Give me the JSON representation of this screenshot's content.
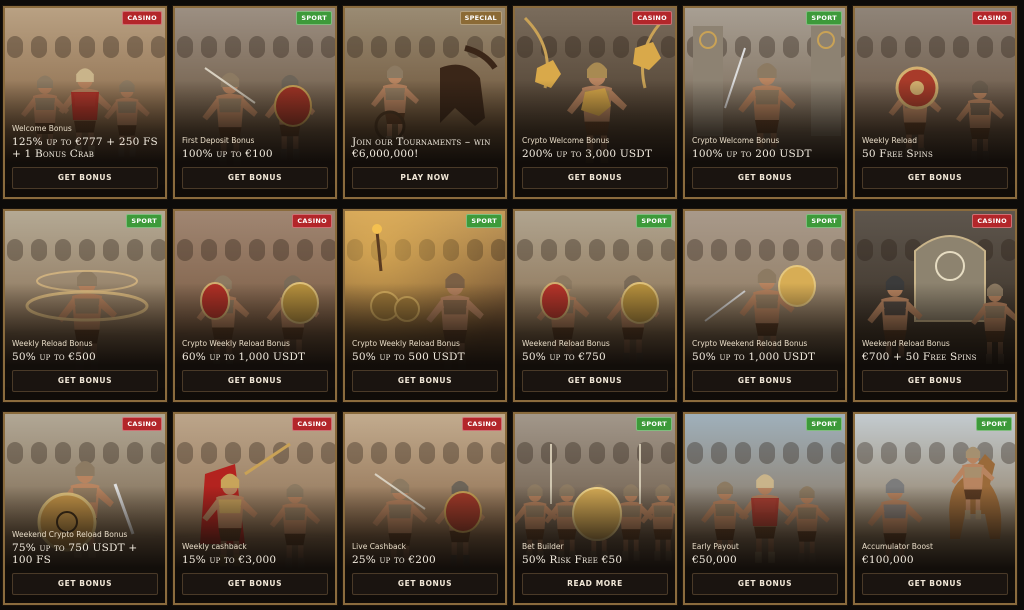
{
  "promotions": [
    {
      "badge": "CASINO",
      "badge_type": "casino",
      "subtitle": "Welcome Bonus",
      "title": "125% up to €777 + 250 FS + 1 Bonus Crab",
      "button": "GET BONUS",
      "scene": "arena-group",
      "sky": "#b9a183",
      "ground": "#8a6a4a",
      "accent": "#b52a22"
    },
    {
      "badge": "SPORT",
      "badge_type": "sport",
      "subtitle": "First Deposit Bonus",
      "title": "100% up to €100",
      "button": "GET BONUS",
      "scene": "fight",
      "sky": "#9c8f82",
      "ground": "#6d5944",
      "accent": "#a23426"
    },
    {
      "badge": "SPECIAL",
      "badge_type": "special",
      "subtitle": "",
      "title": "Join our Tournaments – win €6,000,000!",
      "button": "PLAY NOW",
      "scene": "chariot",
      "sky": "#9a8b73",
      "ground": "#6c5338",
      "accent": "#8a2a20"
    },
    {
      "badge": "CASINO",
      "badge_type": "casino",
      "subtitle": "Crypto Welcome Bonus",
      "title": "200% up to 3,000 USDT",
      "button": "GET BONUS",
      "scene": "coins",
      "sky": "#7a6c5c",
      "ground": "#4e3f30",
      "accent": "#d9a94a"
    },
    {
      "badge": "SPORT",
      "badge_type": "sport",
      "subtitle": "Crypto Welcome Bonus",
      "title": "100% up to 200 USDT",
      "button": "GET BONUS",
      "scene": "pillars",
      "sky": "#a89f93",
      "ground": "#7a6a58",
      "accent": "#c9a256"
    },
    {
      "badge": "CASINO",
      "badge_type": "casino",
      "subtitle": "Weekly Reload",
      "title": "50 Free Spins",
      "button": "GET BONUS",
      "scene": "shield",
      "sky": "#8f8478",
      "ground": "#6a5644",
      "accent": "#a83b2a"
    },
    {
      "badge": "SPORT",
      "badge_type": "sport",
      "subtitle": "Weekly Reload Bonus",
      "title": "50% up to €500",
      "button": "GET BONUS",
      "scene": "spin",
      "sky": "#b4a994",
      "ground": "#8a7258",
      "accent": "#e3c184"
    },
    {
      "badge": "CASINO",
      "badge_type": "casino",
      "subtitle": "Crypto Weekly Reload Bonus",
      "title": "60% up to 1,000 USDT",
      "button": "GET BONUS",
      "scene": "duel",
      "sky": "#a08672",
      "ground": "#7b5c44",
      "accent": "#b23026"
    },
    {
      "badge": "SPORT",
      "badge_type": "sport",
      "subtitle": "Crypto Weekly Reload Bonus",
      "title": "50% up to 500 USDT",
      "button": "GET BONUS",
      "scene": "torch",
      "sky": "#c49a5a",
      "ground": "#6c4c2e",
      "accent": "#f0b04a"
    },
    {
      "badge": "SPORT",
      "badge_type": "sport",
      "subtitle": "Weekend Reload Bonus",
      "title": "50% up to €750",
      "button": "GET BONUS",
      "scene": "duel",
      "sky": "#b0a48f",
      "ground": "#8a7154",
      "accent": "#b8342a"
    },
    {
      "badge": "SPORT",
      "badge_type": "sport",
      "subtitle": "Crypto Weekend Reload Bonus",
      "title": "50% up to 1,000 USDT",
      "button": "GET BONUS",
      "scene": "arena-single",
      "sky": "#a8998a",
      "ground": "#8f7a60",
      "accent": "#d7ad55"
    },
    {
      "badge": "CASINO",
      "badge_type": "casino",
      "subtitle": "Weekend Reload Bonus",
      "title": "€700 + 50 Free Spins",
      "button": "GET BONUS",
      "scene": "gate",
      "sky": "#5e564d",
      "ground": "#3e342a",
      "accent": "#d8cdb2"
    },
    {
      "badge": "CASINO",
      "badge_type": "casino",
      "subtitle": "Weekend Crypto Reload Bonus",
      "title": "75% up to 750 USDT + 100 FS",
      "button": "GET BONUS",
      "scene": "bigshield",
      "sky": "#b1a795",
      "ground": "#7e6a52",
      "accent": "#c59548"
    },
    {
      "badge": "CASINO",
      "badge_type": "casino",
      "subtitle": "Weekly cashback",
      "title": "15% up to €3,000",
      "button": "GET BONUS",
      "scene": "emperor",
      "sky": "#bca58a",
      "ground": "#8e7256",
      "accent": "#b3231f"
    },
    {
      "badge": "CASINO",
      "badge_type": "casino",
      "subtitle": "Live Cashback",
      "title": "25% up to €200",
      "button": "GET BONUS",
      "scene": "fight",
      "sky": "#c2ab8e",
      "ground": "#8c6c4e",
      "accent": "#a33a2a"
    },
    {
      "badge": "SPORT",
      "badge_type": "sport",
      "subtitle": "Bet Builder",
      "title": "50% Risk Free €50",
      "button": "READ MORE",
      "scene": "army",
      "sky": "#a2978a",
      "ground": "#6b5a48",
      "accent": "#d4aa55"
    },
    {
      "badge": "SPORT",
      "badge_type": "sport",
      "subtitle": "Early Payout",
      "title": "€50,000",
      "button": "GET BONUS",
      "scene": "arena-group",
      "sky": "#9fb0bb",
      "ground": "#8a7660",
      "accent": "#a8332a"
    },
    {
      "badge": "SPORT",
      "badge_type": "sport",
      "subtitle": "Accumulator Boost",
      "title": "€100,000",
      "button": "GET BONUS",
      "scene": "horse",
      "sky": "#c3cbcf",
      "ground": "#8f7c62",
      "accent": "#9a6a3a"
    }
  ]
}
